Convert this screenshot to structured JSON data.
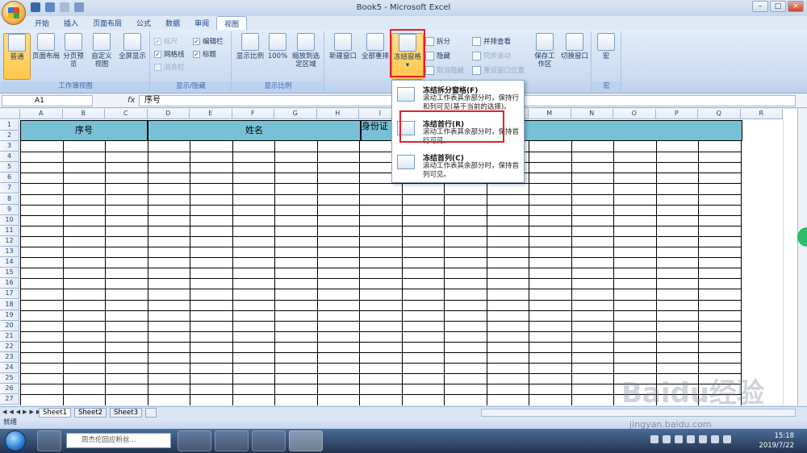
{
  "window": {
    "title": "Book5 - Microsoft Excel"
  },
  "tabs": [
    "开始",
    "插入",
    "页面布局",
    "公式",
    "数据",
    "审阅",
    "视图"
  ],
  "ribbon": {
    "workbook_views": {
      "label": "工作簿视图",
      "buttons": [
        "普通",
        "页面布局",
        "分页预览",
        "自定义视图",
        "全屏显示"
      ]
    },
    "show_hide": {
      "label": "显示/隐藏",
      "items": [
        {
          "label": "标尺",
          "checked": "✓",
          "enabled": false
        },
        {
          "label": "网格线",
          "checked": "✓",
          "enabled": true
        },
        {
          "label": "消息栏",
          "checked": "",
          "enabled": false
        },
        {
          "label": "编辑栏",
          "checked": "✓",
          "enabled": true
        },
        {
          "label": "标题",
          "checked": "✓",
          "enabled": true
        }
      ]
    },
    "zoom": {
      "label": "显示比例",
      "buttons": [
        "显示比例",
        "100%",
        "缩放到选定区域"
      ]
    },
    "window_group": {
      "buttons": [
        "新建窗口",
        "全部重排",
        "冻结窗格"
      ],
      "small": [
        "拆分",
        "隐藏",
        "取消隐藏",
        "并排查看",
        "同步滚动",
        "重设窗口位置"
      ],
      "save": "保存工作区",
      "switch": "切换窗口"
    },
    "macro": {
      "label": "宏",
      "button": "宏"
    }
  },
  "formula_bar": {
    "name_box": "A1",
    "fx": "fx",
    "content": "序号"
  },
  "columns": [
    "A",
    "B",
    "C",
    "D",
    "E",
    "F",
    "G",
    "H",
    "I",
    "J",
    "K",
    "L",
    "M",
    "N",
    "O",
    "P",
    "Q",
    "R"
  ],
  "rows": [
    "1",
    "2",
    "3",
    "4",
    "5",
    "6",
    "7",
    "8",
    "9",
    "10",
    "11",
    "12",
    "13",
    "14",
    "15",
    "16",
    "17",
    "18",
    "19",
    "20",
    "21",
    "22",
    "23",
    "24",
    "25",
    "26",
    "27"
  ],
  "headers": {
    "seq": "序号",
    "name": "姓名",
    "id": "身份证"
  },
  "dropdown": {
    "items": [
      {
        "title": "冻结拆分窗格(F)",
        "desc": "滚动工作表其余部分时，保持行和列可见(基于当前的选择)。"
      },
      {
        "title": "冻结首行(R)",
        "desc": "滚动工作表其余部分时，保持首行可见。"
      },
      {
        "title": "冻结首列(C)",
        "desc": "滚动工作表其余部分时，保持首列可见。"
      }
    ]
  },
  "sheets": [
    "Sheet1",
    "Sheet2",
    "Sheet3"
  ],
  "status": "就绪",
  "taskbar": {
    "search_text": "周杰伦回应粉丝...",
    "search_btn": "搜索",
    "time": "15:18",
    "date": "2019/7/22"
  },
  "watermark": "Baidu经验",
  "watermark_url": "jingyan.baidu.com",
  "colors": {
    "header_fill": "#78c0d6",
    "highlight": "#e3202a"
  }
}
